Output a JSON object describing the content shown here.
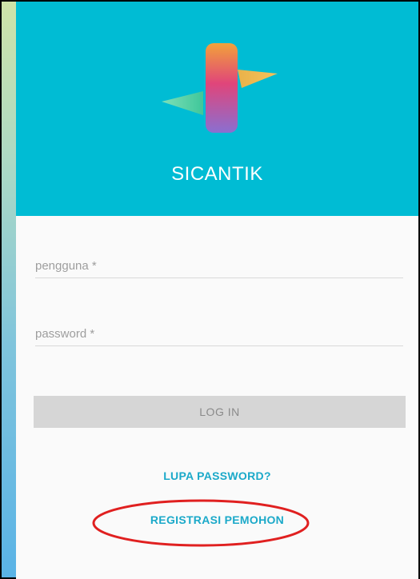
{
  "app": {
    "title": "SICANTIK"
  },
  "form": {
    "username_placeholder": "pengguna *",
    "password_placeholder": "password *",
    "login_label": "LOG IN"
  },
  "links": {
    "forgot_password": "LUPA PASSWORD?",
    "register": "REGISTRASI PEMOHON"
  },
  "colors": {
    "header": "#00bcd4",
    "link": "#1ba9c9",
    "annotation": "#e02020"
  },
  "icons": {
    "logo": "sicantik-logo-icon"
  }
}
